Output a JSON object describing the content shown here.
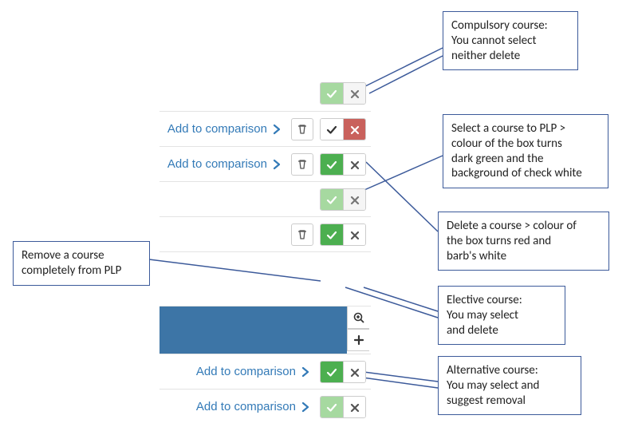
{
  "rows": {
    "r1": {
      "check_color": "light-green",
      "x_color": "grey-bg"
    },
    "r2": {
      "link": "Add to comparison",
      "has_trash": true,
      "check_side": "white-bg",
      "x_side": "red-bg"
    },
    "r3": {
      "link": "Add to comparison",
      "has_trash": true,
      "check_color": "dark-green",
      "x_color": "white-bg"
    },
    "r4": {
      "check_color": "light-green",
      "x_color": "grey-bg"
    },
    "r5": {
      "has_trash": true,
      "check_color": "dark-green",
      "x_color": "white-bg"
    },
    "r6": {
      "link": "Add to comparison",
      "check_color": "dark-green",
      "x_color": "white-bg"
    },
    "r7": {
      "link": "Add to comparison",
      "check_color": "light-green",
      "x_color": "white-bg"
    }
  },
  "callouts": {
    "c1": "Compulsory course:\nYou cannot select\nneither delete",
    "c2": "Select a course to PLP >\ncolour of the box turns\ndark green and the\nbackground of check white",
    "c3": "Delete a course > colour of\nthe box turns red  and\nbarb's white",
    "c4": "Remove a course\ncompletely from PLP",
    "c5": "Elective course:\nYou may select\nand delete",
    "c6": "Alternative course:\nYou may select and\nsuggest removal"
  },
  "icons": {
    "check": "check-icon",
    "x": "x-icon",
    "trash": "trash-icon",
    "chevron": "chevron-right-icon",
    "zoom": "zoom-in-icon",
    "plus": "plus-icon"
  }
}
